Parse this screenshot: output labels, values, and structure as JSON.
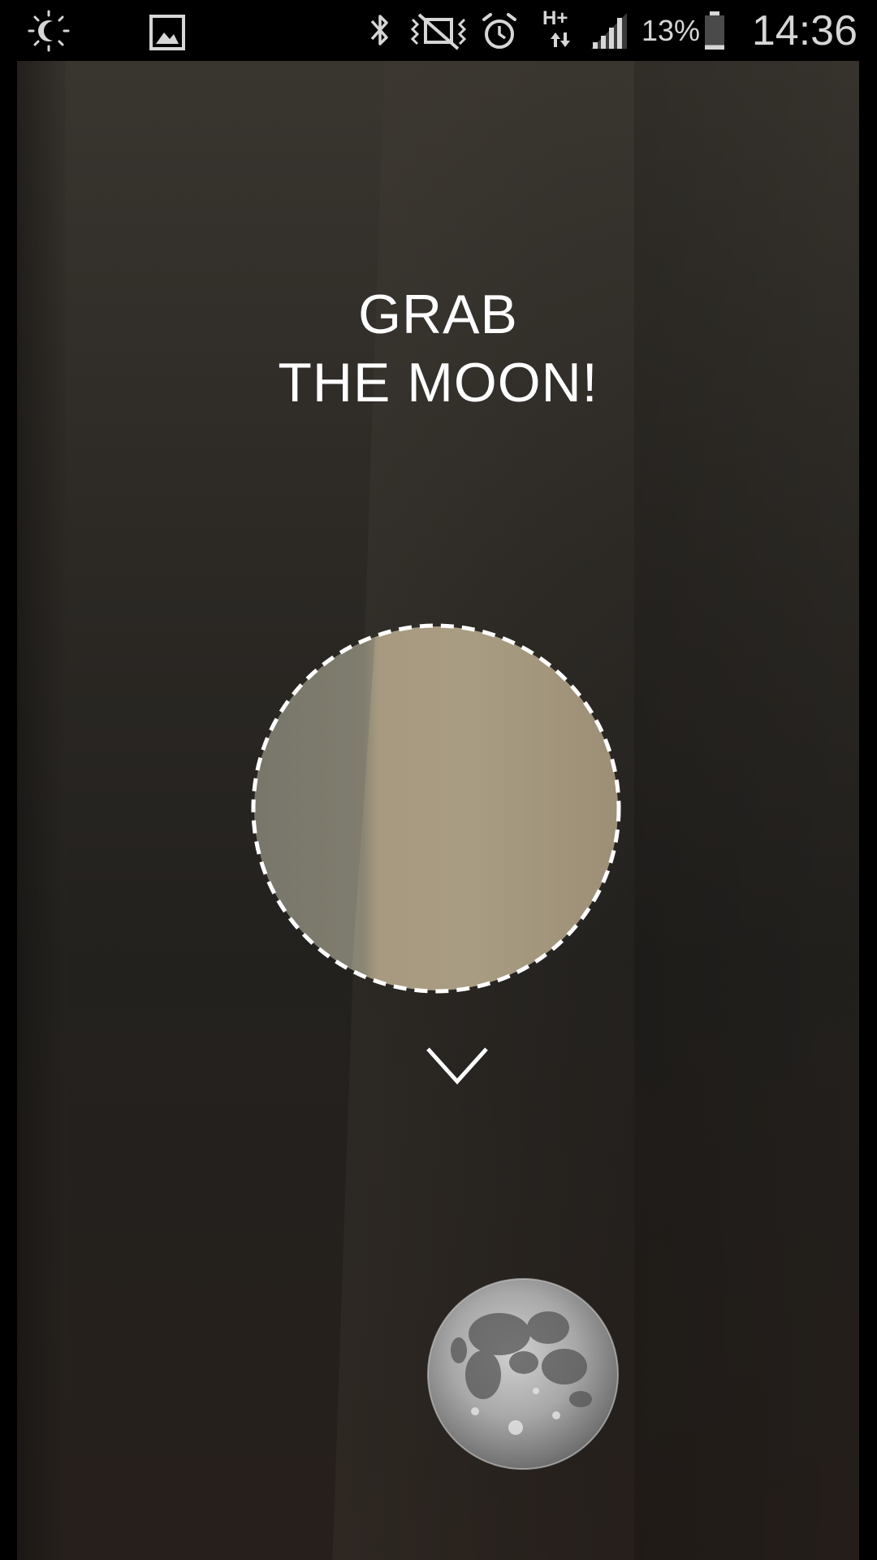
{
  "status_bar": {
    "battery_percent": "13%",
    "time": "14:36",
    "network_type": "H+",
    "icons": [
      "brightness-icon",
      "gallery-icon",
      "bluetooth-icon",
      "vibrate-icon",
      "alarm-icon",
      "network-icon",
      "signal-icon",
      "battery-icon"
    ],
    "battery_level": 0.13
  },
  "main": {
    "title_line1": "GRAB",
    "title_line2": "THE MOON!",
    "target_label": "",
    "colors": {
      "text": "#ffffff",
      "target_fill": "#a49880",
      "ring": "#ffffff"
    }
  }
}
